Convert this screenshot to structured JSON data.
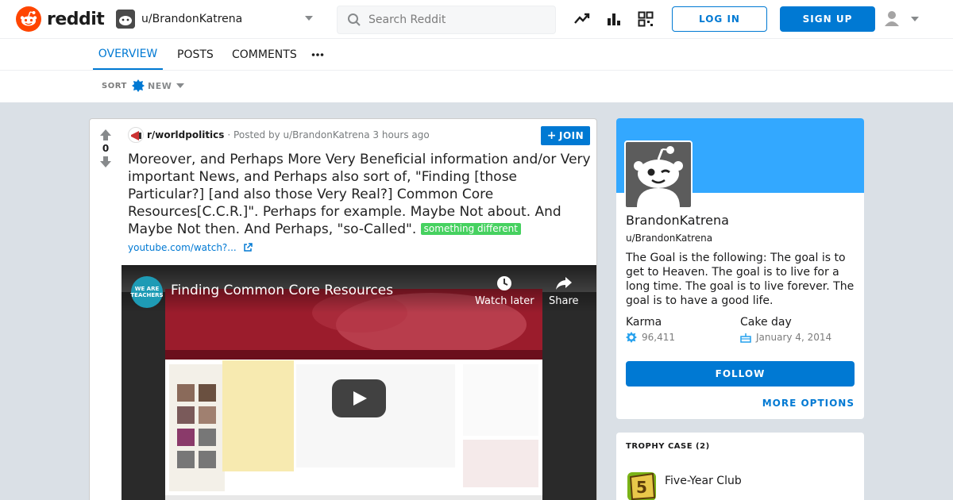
{
  "header": {
    "brand": "reddit",
    "current_user": "u/BrandonKatrena",
    "search_placeholder": "Search Reddit",
    "login_label": "LOG IN",
    "signup_label": "SIGN UP"
  },
  "tabs": [
    {
      "label": "OVERVIEW",
      "active": true
    },
    {
      "label": "POSTS",
      "active": false
    },
    {
      "label": "COMMENTS",
      "active": false
    }
  ],
  "sort": {
    "label": "SORT",
    "value": "NEW"
  },
  "post": {
    "votes": "0",
    "subreddit": "r/worldpolitics",
    "posted_by": "· Posted by u/BrandonKatrena 3 hours ago",
    "join_label": "JOIN",
    "title": "Moreover, and Perhaps More Very Beneficial information and/or Very important News, and Perhaps also sort of, \"Finding [those Particular?] [and also those Very Real?] Common Core Resources[C.C.R.]\". Perhaps for example. Maybe Not about. And Maybe Not then. And Perhaps, \"so-Called\".",
    "flair": "something different",
    "link": "youtube.com/watch?...",
    "video": {
      "channel": "WE ARE TEACHERS",
      "title": "Finding Common Core Resources",
      "watch_later": "Watch later",
      "share": "Share"
    }
  },
  "profile": {
    "display_name": "BrandonKatrena",
    "handle": "u/BrandonKatrena",
    "bio": "The Goal is the following: The goal is to get to Heaven. The goal is to live for a long time. The goal is to live forever. The goal is to have a good life.",
    "karma_label": "Karma",
    "karma_value": "96,411",
    "cake_label": "Cake day",
    "cake_value": "January 4, 2014",
    "follow_label": "FOLLOW",
    "more_options_label": "MORE OPTIONS"
  },
  "trophy_case": {
    "title": "TROPHY CASE (2)",
    "items": [
      {
        "name": "Five-Year Club",
        "icon": "five-year-club-icon"
      }
    ]
  },
  "colors": {
    "accent": "#0079d3",
    "brand": "#ff4500",
    "banner": "#33a8ff",
    "flair": "#46d160"
  }
}
